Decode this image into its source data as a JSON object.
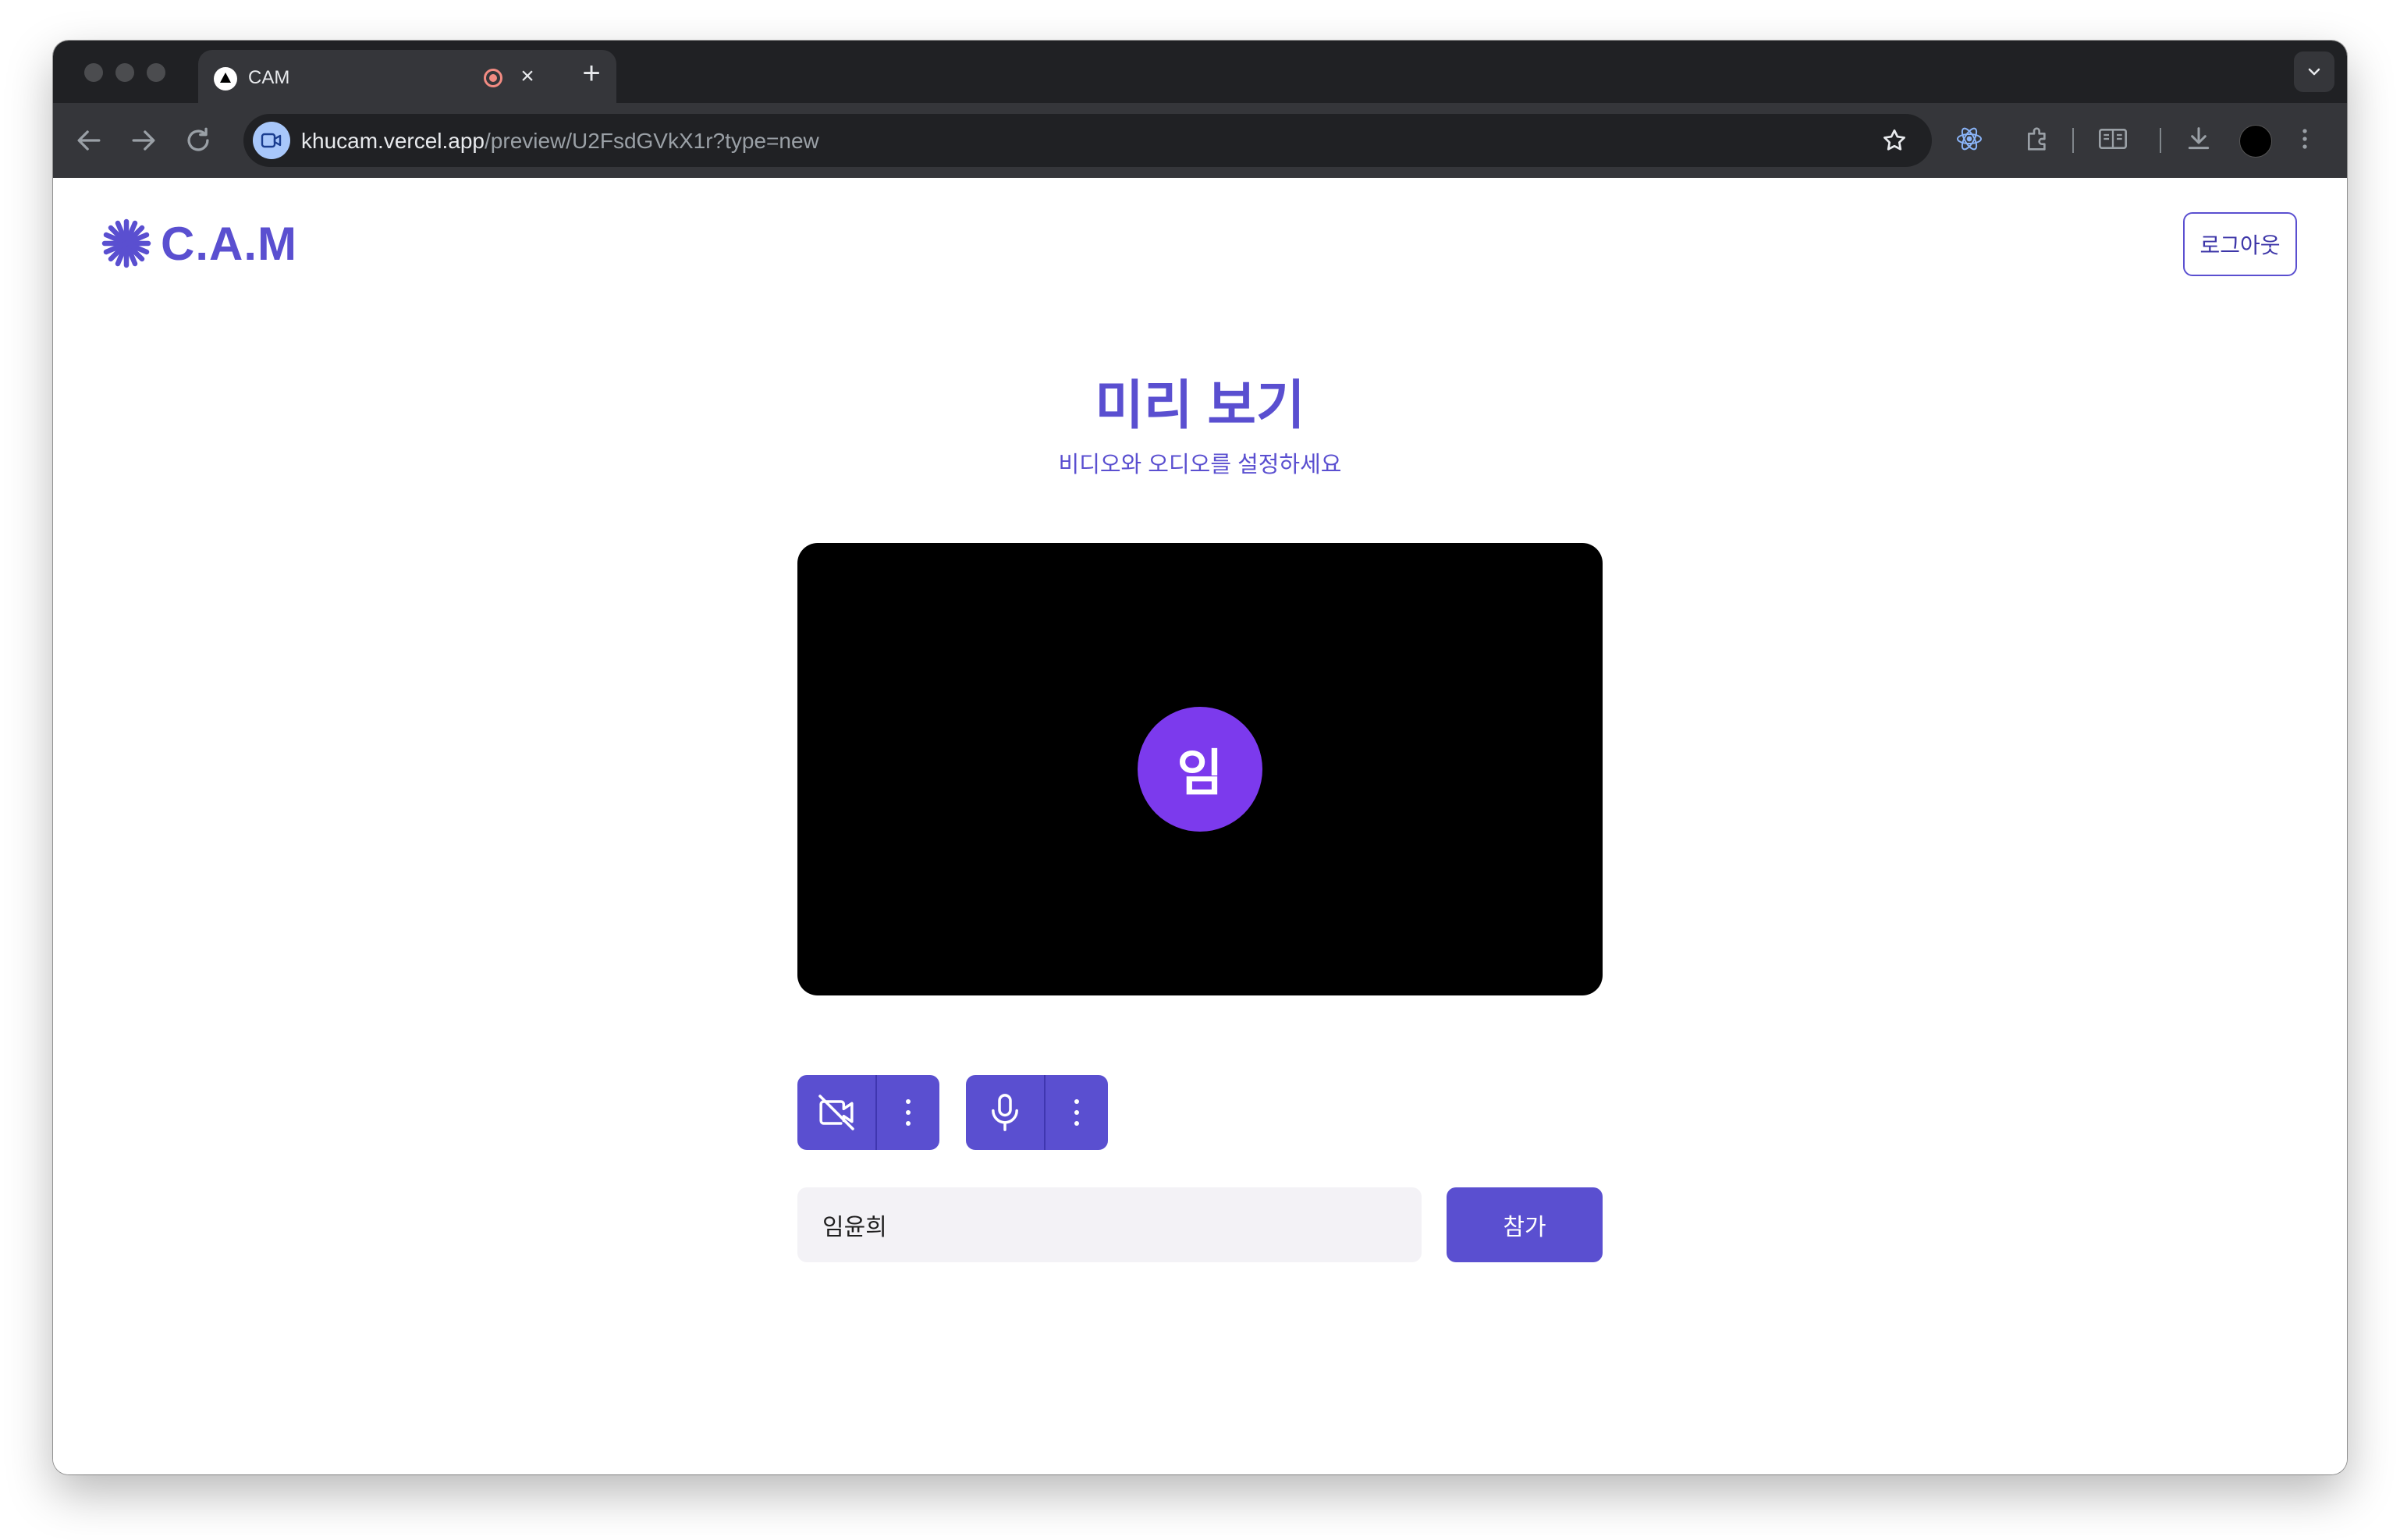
{
  "browser": {
    "tab": {
      "title": "CAM"
    },
    "address": {
      "host": "khucam.vercel.app",
      "path": "/preview/U2FsdGVkX1r?type=new"
    }
  },
  "header": {
    "logo_text": "C.A.M",
    "logout_label": "로그아웃"
  },
  "main": {
    "title": "미리 보기",
    "subtitle": "비디오와 오디오를 설정하세요",
    "avatar_initial": "임",
    "video_on": false,
    "mic_on": true,
    "name_value": "임윤희",
    "join_label": "참가"
  },
  "colors": {
    "accent": "#5a4fd0",
    "avatar": "#7c3aed",
    "input_bg": "#f3f2f6"
  }
}
